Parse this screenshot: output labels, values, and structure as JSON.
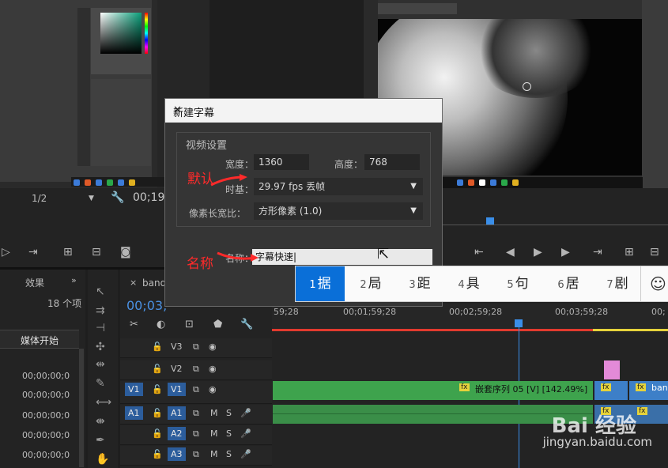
{
  "dialog": {
    "title": "新建字幕",
    "group_title": "视频设置",
    "width_label": "宽度：",
    "width_value": "1360",
    "height_label": "高度：",
    "height_value": "768",
    "timebase_label": "时基：",
    "timebase_value": "29.97 fps 丢帧",
    "pixel_aspect_label": "像素长宽比：",
    "pixel_aspect_value": "方形像素 (1.0)",
    "name_label": "名称：",
    "name_value": "字幕快速"
  },
  "annotations": {
    "default": "默认",
    "name": "名称"
  },
  "ime": {
    "candidates": [
      {
        "num": "1",
        "text": "据"
      },
      {
        "num": "2",
        "text": "局"
      },
      {
        "num": "3",
        "text": "距"
      },
      {
        "num": "4",
        "text": "具"
      },
      {
        "num": "5",
        "text": "句"
      },
      {
        "num": "6",
        "text": "居"
      },
      {
        "num": "7",
        "text": "剧"
      }
    ],
    "emoji": "☺"
  },
  "program_monitor": {
    "zoom": "1/2",
    "timecode": "00;19"
  },
  "project_panel": {
    "tab": "效果",
    "item_count": "18 个项",
    "column": "媒体开始",
    "rows": [
      "00;00;00;0",
      "00;00;00;0",
      "00;00;00;0",
      "00;00;00;0",
      "00;00;00;0"
    ]
  },
  "timeline": {
    "tab": "band",
    "timecode": "00;03;",
    "ruler": [
      "59;28",
      "00;01;59;28",
      "00;02;59;28",
      "00;03;59;28",
      "00;"
    ],
    "tracks": {
      "v3": "V3",
      "v2": "V2",
      "v1_src": "V1",
      "v1": "V1",
      "a1_src": "A1",
      "a1": "A1",
      "a2": "A2",
      "a3": "A3"
    },
    "clip_label": "嵌套序列 05 [V] [142.49%]",
    "clip_label2": "ban",
    "fx": "fx",
    "m": "M",
    "s": "S"
  },
  "watermark": {
    "brand": "Bai 经验",
    "url": "jingyan.baidu.com"
  }
}
